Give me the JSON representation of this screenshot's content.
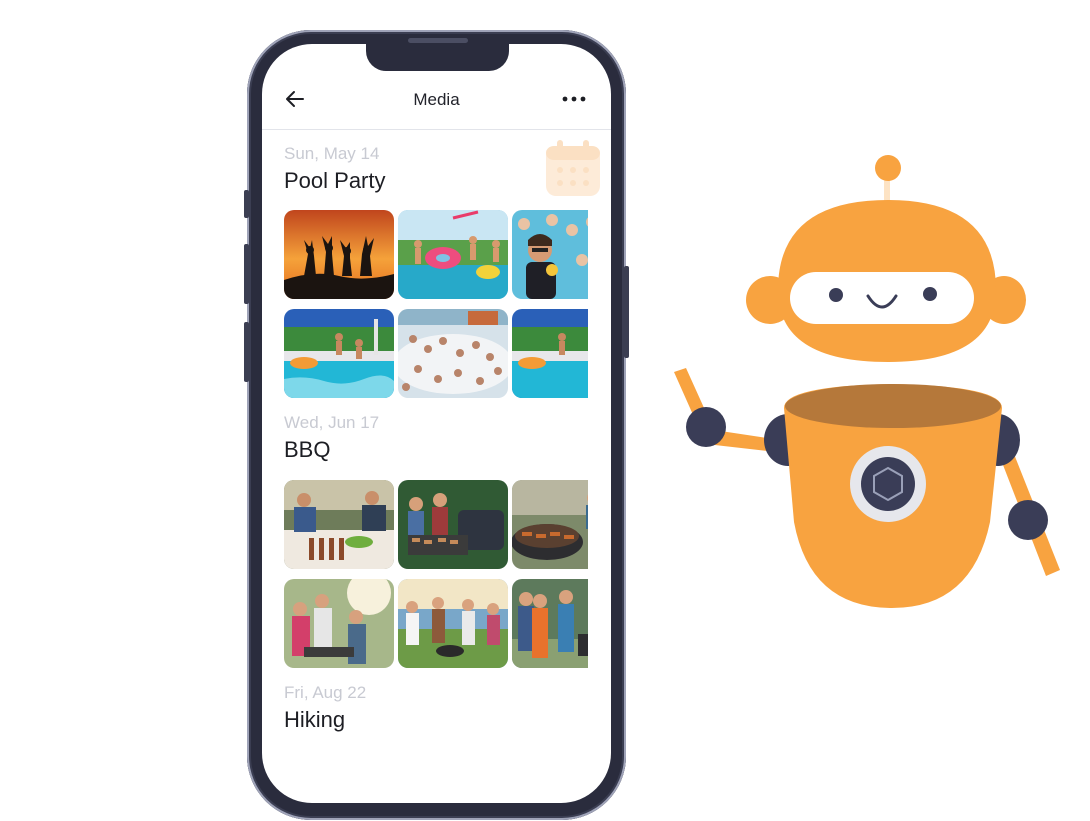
{
  "app": {
    "title": "Media"
  },
  "sections": [
    {
      "date": "Sun, May 14",
      "title": "Pool Party",
      "photos": [
        "party-silhouettes-sunset",
        "pool-float-party",
        "pool-crowd-selfie",
        "pool-jump",
        "foam-party-crowd",
        "pool-jump-2"
      ]
    },
    {
      "date": "Wed, Jun 17",
      "title": "BBQ",
      "photos": [
        "bbq-table-feast",
        "bbq-grill-friends",
        "bbq-grill-meat",
        "bbq-outdoor-lunch",
        "bbq-friends-drinks",
        "bbq-group-apron"
      ]
    },
    {
      "date": "Fri, Aug 22",
      "title": "Hiking",
      "photos": []
    }
  ],
  "icons": {
    "back": "arrow-left-icon",
    "more": "more-horizontal-icon",
    "calendar": "calendar-icon"
  },
  "colors": {
    "accent": "#f8a340",
    "accent_light": "#fde9d2",
    "robot_dark": "#3a3d57",
    "text_muted": "#c8cad2",
    "text_primary": "#1d1e24"
  }
}
